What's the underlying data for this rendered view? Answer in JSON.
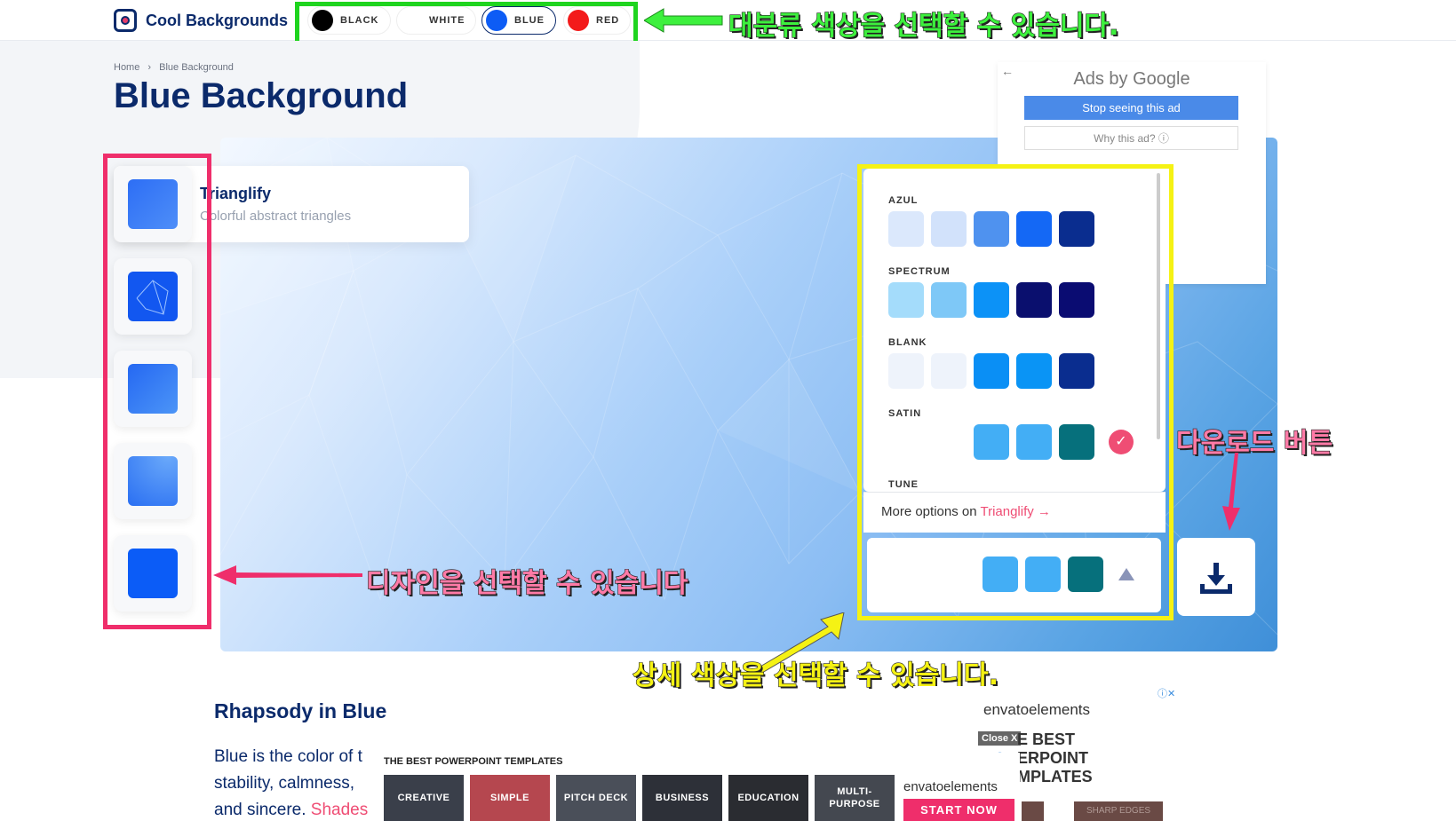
{
  "brand": {
    "name": "Cool Backgrounds"
  },
  "color_filters": [
    {
      "label": "BLACK",
      "color": "#000000"
    },
    {
      "label": "WHITE",
      "color": "#ffffff"
    },
    {
      "label": "BLUE",
      "color": "#0d5cf5",
      "selected": true
    },
    {
      "label": "RED",
      "color": "#f31a1a"
    }
  ],
  "annotations": {
    "color_category": "대분류 색상을 선택할 수 있습니다.",
    "design_select": "디자인을 선택할 수 있습니다",
    "detail_color": "상세 색상을 선택할 수 있습니다.",
    "download": "다운로드 버튼"
  },
  "breadcrumb": {
    "home": "Home",
    "sep": "›",
    "current": "Blue Background"
  },
  "page_title": "Blue Background",
  "design": {
    "name": "Trianglify",
    "description": "Colorful abstract triangles"
  },
  "thumbnails": [
    {
      "name": "trianglify",
      "color": "#2d6ef5"
    },
    {
      "name": "constellation",
      "color": "#1257f0"
    },
    {
      "name": "gradient",
      "color": "#2f7ef5"
    },
    {
      "name": "waves",
      "color": "#3a83f2"
    },
    {
      "name": "solid",
      "color": "#0b5cf7"
    }
  ],
  "ads": {
    "title": "Ads by Google",
    "stop": "Stop seeing this ad",
    "why": "Why this ad? ⓘ"
  },
  "palette": {
    "groups": [
      {
        "label": "AZUL",
        "colors": [
          "#dbe8fc",
          "#d2e2fb",
          "#4f92ef",
          "#1468f5",
          "#0a2d8f"
        ]
      },
      {
        "label": "SPECTRUM",
        "colors": [
          "#a4dcfb",
          "#7ec8f7",
          "#0c92f7",
          "#0a0f6e",
          "#0a0c72"
        ]
      },
      {
        "label": "BLANK",
        "colors": [
          "#eef3fb",
          "#eef3fb",
          "#0a8ff5",
          "#0a94f5",
          "#0a2d8f"
        ]
      },
      {
        "label": "SATIN",
        "colors": [
          "#43aef5",
          "#43aef5",
          "#06707c"
        ]
      },
      {
        "label": "TUNE",
        "colors": []
      }
    ],
    "more_prefix": "More options on ",
    "more_link": "Trianglify →"
  },
  "selected_colors": [
    "#43aef5",
    "#43aef5",
    "#06707c"
  ],
  "article": {
    "heading": "Rhapsody in Blue",
    "line1": "Blue is the color of t",
    "line2": "stability, calmness,",
    "line3": "and sincere. ",
    "link": "Shades"
  },
  "envato_ad": {
    "logo": "envatoelements",
    "close": "Close X",
    "big_lines": [
      "E BEST",
      "ERPOINT",
      "MPLATES"
    ],
    "pill": "SHARP EDGES"
  },
  "ppt_ad": {
    "title": "THE BEST POWERPOINT TEMPLATES",
    "categories": [
      "CREATIVE",
      "SIMPLE",
      "PITCH DECK",
      "BUSINESS",
      "EDUCATION",
      "MULTI-\nPURPOSE"
    ],
    "logo": "envatoelements",
    "cta": "START NOW"
  }
}
